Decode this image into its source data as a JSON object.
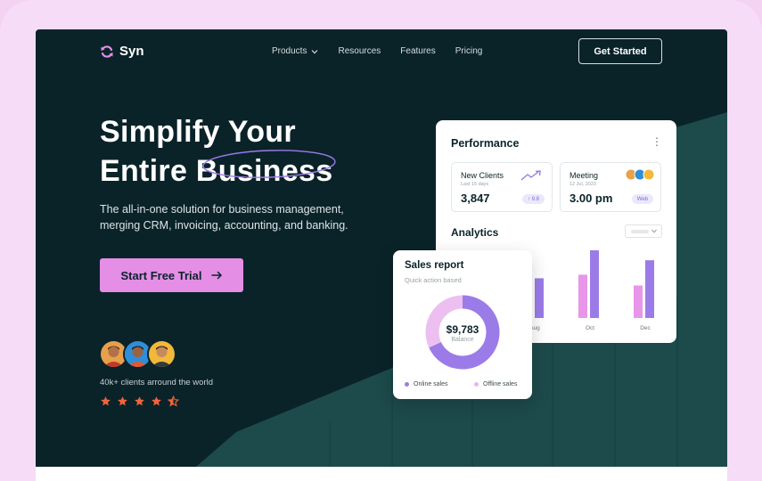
{
  "brand": {
    "name": "Syn"
  },
  "nav": {
    "links": [
      {
        "label": "Products",
        "has_dropdown": true
      },
      {
        "label": "Resources"
      },
      {
        "label": "Features"
      },
      {
        "label": "Pricing"
      }
    ],
    "cta_label": "Get Started"
  },
  "hero": {
    "headline_line1": "Simplify Your",
    "headline_line2": "Entire Business",
    "subtext": "The all-in-one solution for business management, merging CRM, invoicing, accounting, and banking.",
    "button_label": "Start Free Trial",
    "clients_text": "40k+ clients arround the world",
    "rating": 4.5
  },
  "performance": {
    "title": "Performance",
    "new_clients": {
      "title": "New Clients",
      "sub": "Last 15 days",
      "value": "3,847",
      "chip": "↑ 9.8"
    },
    "meeting": {
      "title": "Meeting",
      "sub": "12 Jul, 2023",
      "value": "3.00 pm",
      "chip": "Web"
    },
    "analytics_title": "Analytics"
  },
  "chart_data": {
    "type": "bar",
    "categories": [
      "",
      "Aug",
      "",
      "Oct",
      "",
      "Dec"
    ],
    "series": [
      {
        "values": [
          0,
          15,
          0,
          48,
          0,
          36
        ]
      },
      {
        "values": [
          0,
          44,
          0,
          75,
          0,
          64
        ]
      }
    ],
    "colors": [
      "#e796ea",
      "#9b7be8"
    ]
  },
  "sales": {
    "title": "Sales report",
    "subtitle": "Quick action based",
    "value": "$9,783",
    "label": "Balance",
    "online_share": 0.68,
    "legend_online": "Online sales",
    "legend_offline": "Offline sales"
  },
  "colors": {
    "background": "#0a2329",
    "accent_pink": "#e48ee6",
    "accent_purple": "#9b7be8",
    "star": "#f0643c"
  }
}
